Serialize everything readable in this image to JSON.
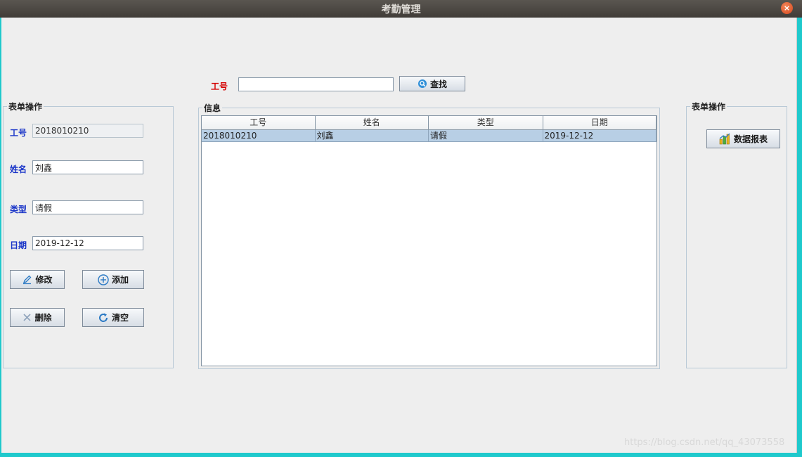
{
  "window": {
    "title": "考勤管理",
    "close_glyph": "×"
  },
  "search": {
    "label": "工号",
    "value": "",
    "button_label": "查找"
  },
  "left_panel": {
    "title": "表单操作",
    "fields": [
      {
        "label": "工号",
        "value": "2018010210"
      },
      {
        "label": "姓名",
        "value": "刘鑫"
      },
      {
        "label": "类型",
        "value": "请假"
      },
      {
        "label": "日期",
        "value": "2019-12-12"
      }
    ],
    "buttons": {
      "edit": "修改",
      "add": "添加",
      "delete": "删除",
      "clear": "清空"
    }
  },
  "info_panel": {
    "title": "信息",
    "columns": [
      "工号",
      "姓名",
      "类型",
      "日期"
    ],
    "rows": [
      [
        "2018010210",
        "刘鑫",
        "请假",
        "2019-12-12"
      ]
    ]
  },
  "right_panel": {
    "title": "表单操作",
    "report_button": "数据报表"
  },
  "watermark": "https://blog.csdn.net/qq_43073558",
  "colors": {
    "label_red": "#d40000",
    "label_blue": "#1a35c8",
    "selected_row": "#b8cfe5",
    "accent": "#1fc9cc"
  },
  "icons": {
    "search": "search-icon",
    "edit": "pencil-icon",
    "add": "plus-circle-icon",
    "delete": "x-icon",
    "clear": "refresh-icon",
    "report": "bar-chart-icon"
  }
}
